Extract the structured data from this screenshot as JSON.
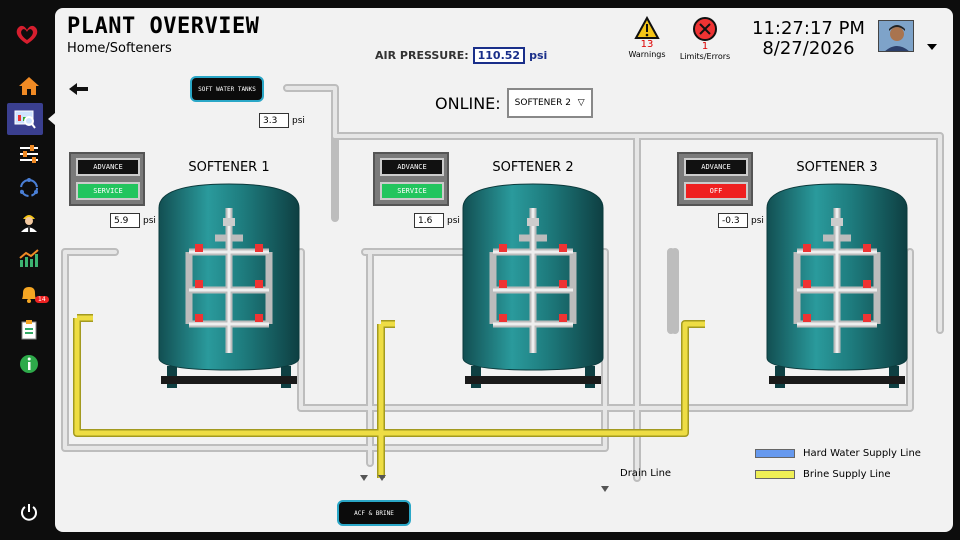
{
  "header": {
    "title": "PLANT OVERVIEW",
    "breadcrumb": "Home/Softeners",
    "air_pressure_label": "AIR PRESSURE:",
    "air_pressure_value": "110.52",
    "air_pressure_unit": "psi",
    "warnings_count": "13",
    "warnings_label": "Warnings",
    "errors_count": "1",
    "errors_label": "Limits/Errors",
    "time": "11:27:17 PM",
    "date": "8/27/2026"
  },
  "sidebar": {
    "items": [
      {
        "name": "home",
        "icon": "home-icon"
      },
      {
        "name": "overview",
        "icon": "monitor-search-icon",
        "active": true
      },
      {
        "name": "settings",
        "icon": "sliders-icon"
      },
      {
        "name": "cycle",
        "icon": "cycle-icon"
      },
      {
        "name": "operator",
        "icon": "worker-icon"
      },
      {
        "name": "trends",
        "icon": "chart-icon"
      },
      {
        "name": "alarms",
        "icon": "bell-icon",
        "badge": "14"
      },
      {
        "name": "reports",
        "icon": "clipboard-icon"
      },
      {
        "name": "info",
        "icon": "info-icon"
      },
      {
        "name": "power",
        "icon": "power-icon"
      }
    ],
    "badge": "14"
  },
  "online": {
    "label": "ONLINE:",
    "selected": "SOFTENER 2"
  },
  "softeners": [
    {
      "name": "SOFTENER 1",
      "advance": "ADVANCE",
      "status": "SERVICE",
      "status_color": "#22c55e",
      "psi": "5.9",
      "unit": "psi"
    },
    {
      "name": "SOFTENER 2",
      "advance": "ADVANCE",
      "status": "SERVICE",
      "status_color": "#22c55e",
      "psi": "1.6",
      "unit": "psi"
    },
    {
      "name": "SOFTENER 3",
      "advance": "ADVANCE",
      "status": "OFF",
      "status_color": "#ef2020",
      "psi": "-0.3",
      "unit": "psi"
    }
  ],
  "soft_water": {
    "label": "SOFT WATER TANKS",
    "psi": "3.3",
    "unit": "psi"
  },
  "acf": {
    "label": "ACF & BRINE"
  },
  "drain_label": "Drain Line",
  "legend": [
    {
      "label": "Hard Water Supply Line",
      "color": "#6699ee"
    },
    {
      "label": "Brine Supply Line",
      "color": "#eeee55"
    }
  ],
  "colors": {
    "accent": "#2aa7c7",
    "tank": "#1f7f82",
    "pipe": "#d6d6d6",
    "brine": "#eedd44"
  }
}
